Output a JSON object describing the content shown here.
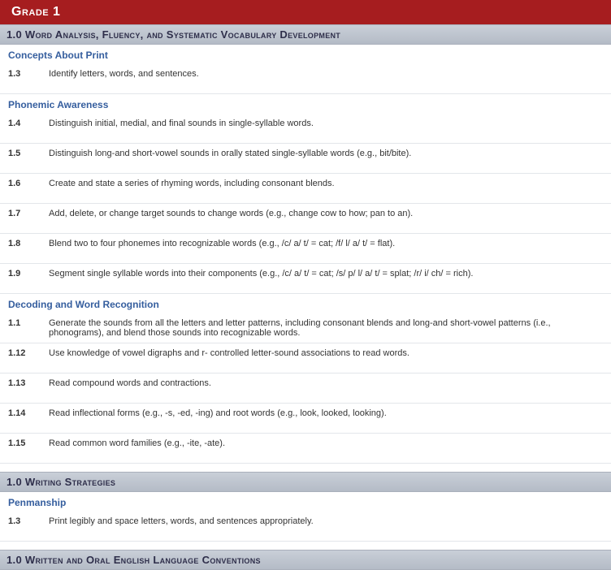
{
  "grade_header": "Grade 1",
  "sections": [
    {
      "title": "1.0 Word Analysis, Fluency, and Systematic Vocabulary Development",
      "groups": [
        {
          "subheader": "Concepts About Print",
          "rows": [
            {
              "num": "1.3",
              "text": "Identify letters, words, and sentences.",
              "double": true
            }
          ]
        },
        {
          "subheader": "Phonemic Awareness",
          "rows": [
            {
              "num": "1.4",
              "text": "Distinguish initial, medial, and final sounds in single-syllable words.",
              "double": true
            },
            {
              "num": "1.5",
              "text": "Distinguish long-and short-vowel sounds in orally stated single-syllable words (e.g., bit/bite).",
              "double": true
            },
            {
              "num": "1.6",
              "text": "Create and state a series of rhyming words, including consonant blends.",
              "double": true
            },
            {
              "num": "1.7",
              "text": "Add, delete, or change target sounds to change words (e.g., change cow to how; pan to an).",
              "double": true
            },
            {
              "num": "1.8",
              "text": "Blend two to four phonemes into recognizable words (e.g., /c/ a/ t/ = cat; /f/ l/ a/ t/ = flat).",
              "double": true
            },
            {
              "num": "1.9",
              "text": "Segment single syllable words into their components (e.g., /c/ a/ t/ = cat; /s/ p/ l/ a/ t/ = splat; /r/ i/ ch/ = rich).",
              "double": true
            }
          ]
        },
        {
          "subheader": "Decoding and Word Recognition",
          "rows": [
            {
              "num": "1.1",
              "text": "Generate the sounds from all the letters and letter patterns, including consonant blends and long-and short-vowel patterns (i.e., phonograms), and blend those sounds into recognizable words."
            },
            {
              "num": "1.12",
              "text": "Use knowledge of vowel digraphs and r- controlled letter-sound associations to read words.",
              "double": true
            },
            {
              "num": "1.13",
              "text": "Read compound words and contractions.",
              "double": true
            },
            {
              "num": "1.14",
              "text": "Read inflectional forms (e.g., -s, -ed, -ing) and root words (e.g., look, looked, looking).",
              "double": true
            },
            {
              "num": "1.15",
              "text": "Read common word families (e.g., -ite, -ate).",
              "double": true
            }
          ]
        }
      ]
    },
    {
      "title": "1.0 Writing Strategies",
      "groups": [
        {
          "subheader": "Penmanship",
          "rows": [
            {
              "num": "1.3",
              "text": "Print legibly and space letters, words, and sentences appropriately.",
              "double": true
            }
          ]
        }
      ]
    },
    {
      "title": "1.0 Written and Oral English Language Conventions",
      "groups": []
    }
  ]
}
